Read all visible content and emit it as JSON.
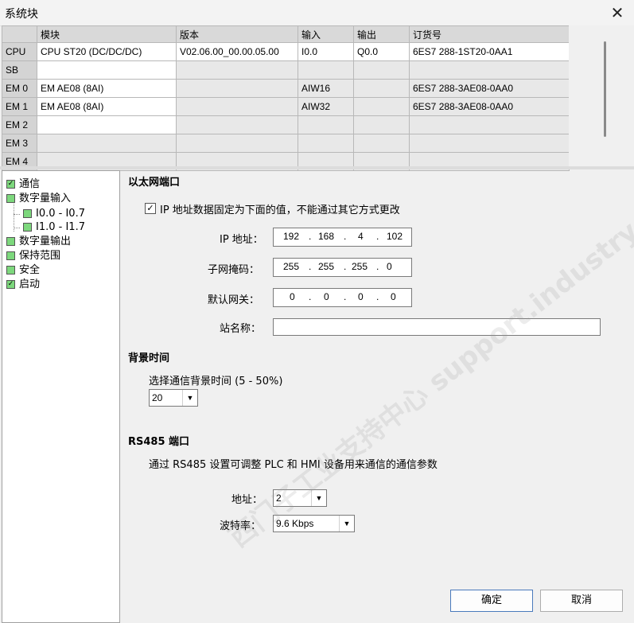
{
  "window": {
    "title": "系统块"
  },
  "table": {
    "headers": [
      "",
      "模块",
      "版本",
      "输入",
      "输出",
      "订货号"
    ],
    "rows": [
      {
        "slot": "CPU",
        "module": "CPU ST20 (DC/DC/DC)",
        "version": "V02.06.00_00.00.05.00",
        "input": "I0.0",
        "output": "Q0.0",
        "order": "6ES7 288-1ST20-0AA1"
      },
      {
        "slot": "SB",
        "module": "",
        "version": "",
        "input": "",
        "output": "",
        "order": ""
      },
      {
        "slot": "EM 0",
        "module": "EM AE08 (8AI)",
        "version": "",
        "input": "AIW16",
        "output": "",
        "order": "6ES7 288-3AE08-0AA0"
      },
      {
        "slot": "EM 1",
        "module": "EM AE08 (8AI)",
        "version": "",
        "input": "AIW32",
        "output": "",
        "order": "6ES7 288-3AE08-0AA0"
      },
      {
        "slot": "EM 2",
        "module": "",
        "version": "",
        "input": "",
        "output": "",
        "order": ""
      },
      {
        "slot": "EM 3",
        "module": "",
        "version": "",
        "input": "",
        "output": "",
        "order": ""
      },
      {
        "slot": "EM 4",
        "module": "",
        "version": "",
        "input": "",
        "output": "",
        "order": ""
      }
    ]
  },
  "tree": {
    "items": [
      {
        "label": "通信",
        "checked": true
      },
      {
        "label": "数字量输入",
        "checked": false
      },
      {
        "label": "I0.0 - I0.7",
        "checked": false
      },
      {
        "label": "I1.0 - I1.7",
        "checked": false
      },
      {
        "label": "数字量输出",
        "checked": false
      },
      {
        "label": "保持范围",
        "checked": false
      },
      {
        "label": "安全",
        "checked": false
      },
      {
        "label": "启动",
        "checked": true
      }
    ]
  },
  "ethernet": {
    "heading": "以太网端口",
    "fixed_ip_label": "IP 地址数据固定为下面的值，不能通过其它方式更改",
    "fixed_ip_checked": true,
    "ip_label": "IP 地址：",
    "ip": [
      "192",
      "168",
      "4",
      "102"
    ],
    "subnet_label": "子网掩码：",
    "subnet": [
      "255",
      "255",
      "255",
      "0"
    ],
    "gateway_label": "默认网关：",
    "gateway": [
      "0",
      "0",
      "0",
      "0"
    ],
    "station_label": "站名称：",
    "station_value": ""
  },
  "background": {
    "heading": "背景时间",
    "select_label": "选择通信背景时间 (5 - 50%)",
    "value": "20"
  },
  "rs485": {
    "heading": "RS485 端口",
    "desc": "通过 RS485 设置可调整 PLC 和 HMI 设备用来通信的通信参数",
    "address_label": "地址：",
    "address_value": "2",
    "baud_label": "波特率：",
    "baud_value": "9.6 Kbps"
  },
  "buttons": {
    "ok": "确定",
    "cancel": "取消"
  },
  "watermark": "西门子工业支持中心 support.industry.siemens.com/cs",
  "colors": {
    "tree_check_green": "#7dd87d",
    "header_gray": "#d9d9d9"
  }
}
